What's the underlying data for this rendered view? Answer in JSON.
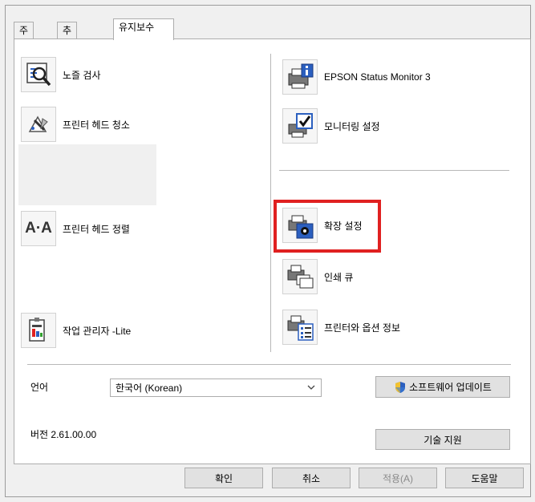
{
  "tabs": [
    {
      "label": "주메뉴"
    },
    {
      "label": "추가 옵션"
    },
    {
      "label": "유지보수"
    }
  ],
  "left_items": [
    {
      "label": "노즐 검사",
      "icon": "nozzle-check-icon"
    },
    {
      "label": "프린터 헤드 청소",
      "icon": "head-cleaning-icon"
    },
    {
      "label": "프린터 헤드 정렬",
      "icon": "head-alignment-icon",
      "glyph": "A·A"
    },
    {
      "label": "작업 관리자 -Lite",
      "icon": "job-manager-icon"
    }
  ],
  "right_items": [
    {
      "label": "EPSON Status Monitor 3",
      "icon": "status-monitor-icon"
    },
    {
      "label": "모니터링 설정",
      "icon": "monitoring-settings-icon"
    },
    {
      "label": "확장 설정",
      "icon": "extended-settings-icon"
    },
    {
      "label": "인쇄 큐",
      "icon": "print-queue-icon"
    },
    {
      "label": "프린터와 옵션 정보",
      "icon": "printer-option-info-icon"
    }
  ],
  "language": {
    "label": "언어",
    "value": "한국어 (Korean)"
  },
  "version": {
    "label": "버전 2.61.00.00"
  },
  "buttons": {
    "software_update": "소프트웨어 업데이트",
    "tech_support": "기술 지원",
    "ok": "확인",
    "cancel": "취소",
    "apply": "적용(A)",
    "help": "도움말"
  },
  "colors": {
    "highlight": "#e02020",
    "accent": "#2b5fbf"
  }
}
